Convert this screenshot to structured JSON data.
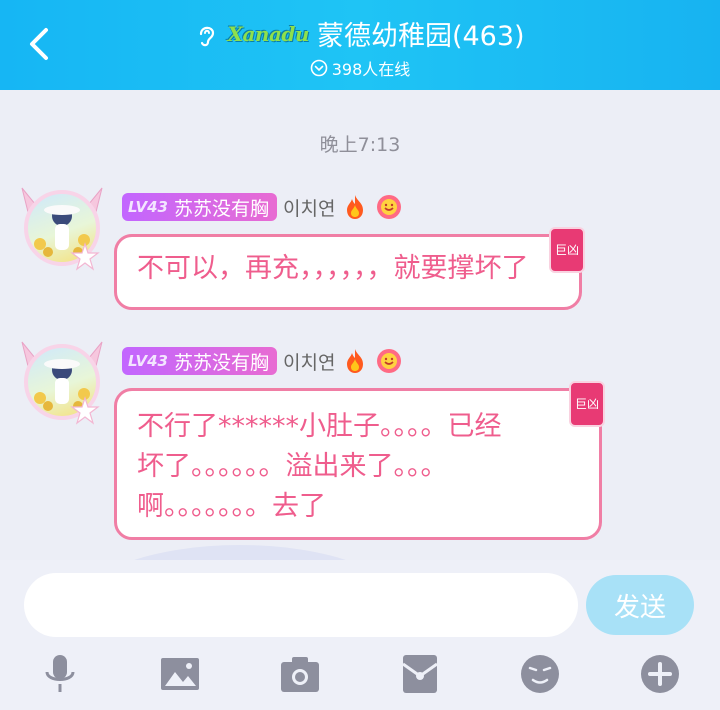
{
  "header": {
    "brand": "Xanadu",
    "title": "蒙德幼稚园(463)",
    "online": "398人在线"
  },
  "chat": {
    "timestamp": "晚上7:13",
    "messages": [
      {
        "level": "LV43",
        "nickname": "苏苏没有胸",
        "tag": "이치연",
        "corner_tag": "巨凶",
        "text": "不可以，再充，，，，，，就要撑坏了"
      },
      {
        "level": "LV43",
        "nickname": "苏苏没有胸",
        "tag": "이치연",
        "corner_tag": "巨凶",
        "lines": [
          "不行了******小肚子。。。。已经",
          "坏了。。。。。。溢出来了。。。",
          "啊。。。。。。。去了"
        ]
      }
    ]
  },
  "input": {
    "value": "",
    "placeholder": "",
    "send_label": "发送"
  },
  "colors": {
    "header": "#1fc4f5",
    "bubble_border": "#f07ea5",
    "bubble_text": "#ef5d8d",
    "badge": "#c266ff",
    "send_button": "#a8e1f7"
  },
  "toolbar": [
    "microphone-icon",
    "image-icon",
    "camera-icon",
    "red-packet-icon",
    "emoji-icon",
    "plus-icon"
  ]
}
